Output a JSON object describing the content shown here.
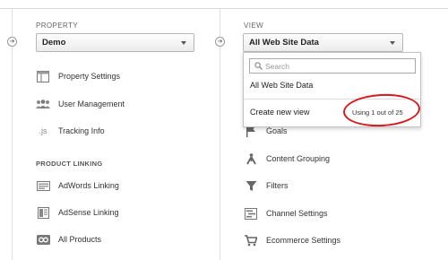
{
  "property": {
    "column_label": "PROPERTY",
    "selected": "Demo",
    "items": [
      {
        "label": "Property Settings",
        "icon": "settings-window-icon"
      },
      {
        "label": "User Management",
        "icon": "users-icon"
      },
      {
        "label": "Tracking Info",
        "icon": "js-icon",
        "icon_text": ".js"
      }
    ],
    "section_label": "PRODUCT LINKING",
    "linking_items": [
      {
        "label": "AdWords Linking",
        "icon": "adwords-icon"
      },
      {
        "label": "AdSense Linking",
        "icon": "adsense-icon"
      },
      {
        "label": "All Products",
        "icon": "all-products-icon"
      }
    ]
  },
  "view": {
    "column_label": "VIEW",
    "selected": "All Web Site Data",
    "dropdown": {
      "search_placeholder": "Search",
      "option": "All Web Site Data",
      "create_label": "Create new view",
      "usage_text": "Using 1 out of 25"
    },
    "items": [
      {
        "label": "Goals",
        "icon": "flag-icon"
      },
      {
        "label": "Content Grouping",
        "icon": "content-grouping-icon"
      },
      {
        "label": "Filters",
        "icon": "filter-icon"
      },
      {
        "label": "Channel Settings",
        "icon": "channel-settings-icon"
      },
      {
        "label": "Ecommerce Settings",
        "icon": "cart-icon"
      }
    ]
  },
  "colors": {
    "annotation": "#d7191c"
  }
}
